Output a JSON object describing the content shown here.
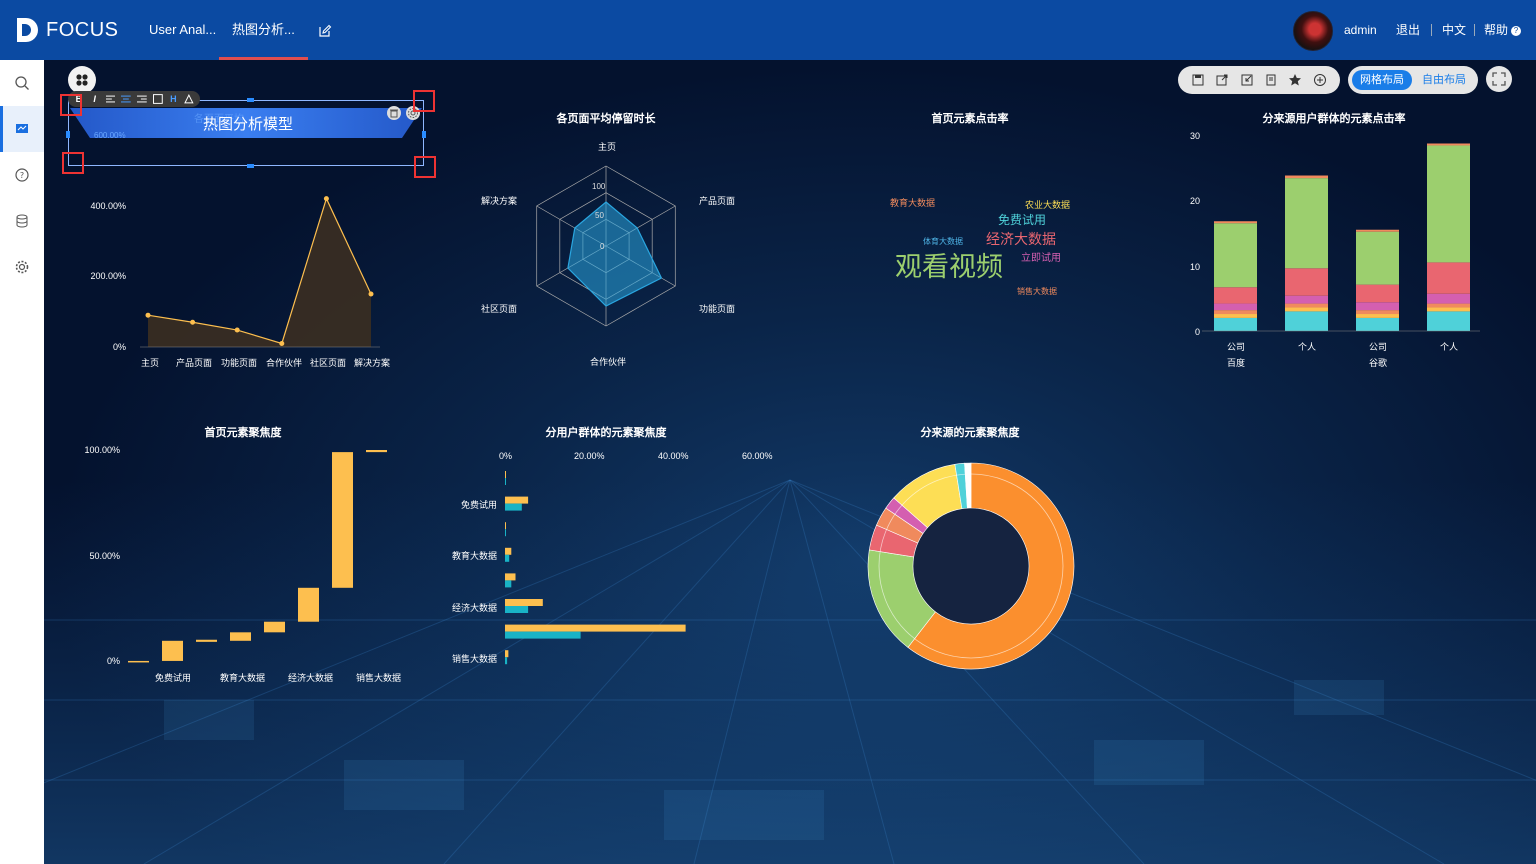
{
  "app": {
    "logo_text": "FOCUS"
  },
  "tabs": [
    {
      "label": "User Anal..."
    },
    {
      "label": "热图分析..."
    }
  ],
  "user": {
    "name": "admin",
    "logout": "退出",
    "language": "中文",
    "help": "帮助"
  },
  "layout": {
    "grid": "网格布局",
    "free": "自由布局"
  },
  "colors": {
    "topbar": "#0b4aa2",
    "accent": "#1a7de8",
    "orange": "#fdbf4f",
    "cyan": "#19b3c6",
    "active_tab_underline": "#e04e4e"
  },
  "text_widget": {
    "title": "热图分析模型",
    "ghost_label": "600.00%",
    "ghost_title": "各页面平均"
  },
  "line_chart": {
    "title": "",
    "y_ticks": [
      "400.00%",
      "200.00%",
      "0%"
    ],
    "categories": [
      "主页",
      "产品页面",
      "功能页面",
      "合作伙伴",
      "社区页面",
      "解决方案"
    ]
  },
  "radar_chart": {
    "title": "各页面平均停留时长",
    "axes": [
      "主页",
      "产品页面",
      "功能页面",
      "合作伙伴",
      "社区页面",
      "解决方案"
    ],
    "ring_labels": [
      "100",
      "50",
      "0"
    ]
  },
  "word_cloud": {
    "title": "首页元素点击率",
    "words": [
      "教育大数据",
      "农业大数据",
      "免费试用",
      "体育大数据",
      "经济大数据",
      "立即试用",
      "观看视频",
      "销售大数据"
    ]
  },
  "stacked_chart": {
    "title": "分来源用户群体的元素点击率",
    "y_ticks": [
      "30",
      "20",
      "10",
      "0"
    ],
    "x_labels": [
      "公司",
      "个人",
      "公司",
      "个人"
    ],
    "groups": [
      "百度",
      "谷歌"
    ]
  },
  "waterfall": {
    "title": "首页元素聚焦度",
    "y_ticks": [
      "100.00%",
      "50.00%",
      "0%"
    ],
    "x_labels": [
      "免费试用",
      "教育大数据",
      "经济大数据",
      "销售大数据"
    ]
  },
  "hbar": {
    "title": "分用户群体的元素聚焦度",
    "x_ticks": [
      "0%",
      "20.00%",
      "40.00%",
      "60.00%"
    ],
    "y_labels": [
      "免费试用",
      "教育大数据",
      "经济大数据",
      "销售大数据"
    ]
  },
  "donut": {
    "title": "分来源的元素聚焦度"
  },
  "chart_data": [
    {
      "type": "area",
      "categories": [
        "主页",
        "产品页面",
        "功能页面",
        "合作伙伴",
        "社区页面",
        "解决方案"
      ],
      "values": [
        90,
        70,
        48,
        10,
        420,
        150
      ],
      "ylim": [
        0,
        600
      ]
    },
    {
      "type": "radar",
      "title": "各页面平均停留时长",
      "categories": [
        "主页",
        "产品页面",
        "功能页面",
        "合作伙伴",
        "社区页面",
        "解决方案"
      ],
      "values": [
        55,
        45,
        80,
        75,
        55,
        45
      ],
      "ylim": [
        0,
        100
      ]
    },
    {
      "type": "bar",
      "title": "分来源用户群体的元素点击率",
      "categories": [
        "公司",
        "个人",
        "公司",
        "个人"
      ],
      "ylim": [
        0,
        30
      ],
      "series": [
        {
          "values": [
            2,
            3,
            2,
            3
          ],
          "color": "#4fd1d9"
        },
        {
          "values": [
            0.6,
            0.6,
            0.6,
            0.6
          ],
          "color": "#fdbf4f"
        },
        {
          "values": [
            0.6,
            0.6,
            0.6,
            0.6
          ],
          "color": "#f08a5d"
        },
        {
          "values": [
            1,
            1.2,
            1.2,
            1.5
          ],
          "color": "#d45fb0"
        },
        {
          "values": [
            2.5,
            4.2,
            2.7,
            4.8
          ],
          "color": "#e96670"
        },
        {
          "values": [
            9.8,
            13.8,
            8.1,
            17.9
          ],
          "color": "#9ccf6e"
        },
        {
          "values": [
            0.3,
            0.4,
            0.3,
            0.3
          ],
          "color": "#f08a5d"
        }
      ]
    },
    {
      "type": "bar",
      "title": "首页元素聚焦度",
      "categories": [
        "",
        "免费试用",
        "",
        "教育大数据",
        "",
        "经济大数据",
        "",
        "销售大数据"
      ],
      "ranges": [
        [
          0,
          0.5
        ],
        [
          0.5,
          10
        ],
        [
          9.5,
          10.5
        ],
        [
          10,
          14
        ],
        [
          14,
          19
        ],
        [
          19,
          35
        ],
        [
          35,
          99
        ],
        [
          99,
          100
        ]
      ],
      "ylim": [
        0,
        100
      ]
    },
    {
      "type": "bar",
      "title": "分用户群体的元素聚焦度",
      "orientation": "horizontal",
      "categories": [
        "",
        "免费试用",
        "",
        "教育大数据",
        "",
        "经济大数据",
        "",
        "销售大数据"
      ],
      "series": [
        {
          "values": [
            0.2,
            5.5,
            0.2,
            1.5,
            2.5,
            9,
            43,
            0.8
          ],
          "color": "#fdbf4f"
        },
        {
          "values": [
            0.2,
            4,
            0.2,
            1,
            1.5,
            5.5,
            18,
            0.5
          ],
          "color": "#19b3c6"
        }
      ],
      "xlim": [
        0,
        60
      ]
    },
    {
      "type": "pie",
      "title": "分来源的元素聚焦度",
      "values": [
        60.5,
        17,
        4,
        3,
        2,
        11,
        1.5,
        1
      ],
      "colors": [
        "#fb8f2e",
        "#9ccf6e",
        "#e96670",
        "#f08a5d",
        "#d45fb0",
        "#fdde55",
        "#4fd1d9",
        "#ffffff"
      ]
    }
  ]
}
